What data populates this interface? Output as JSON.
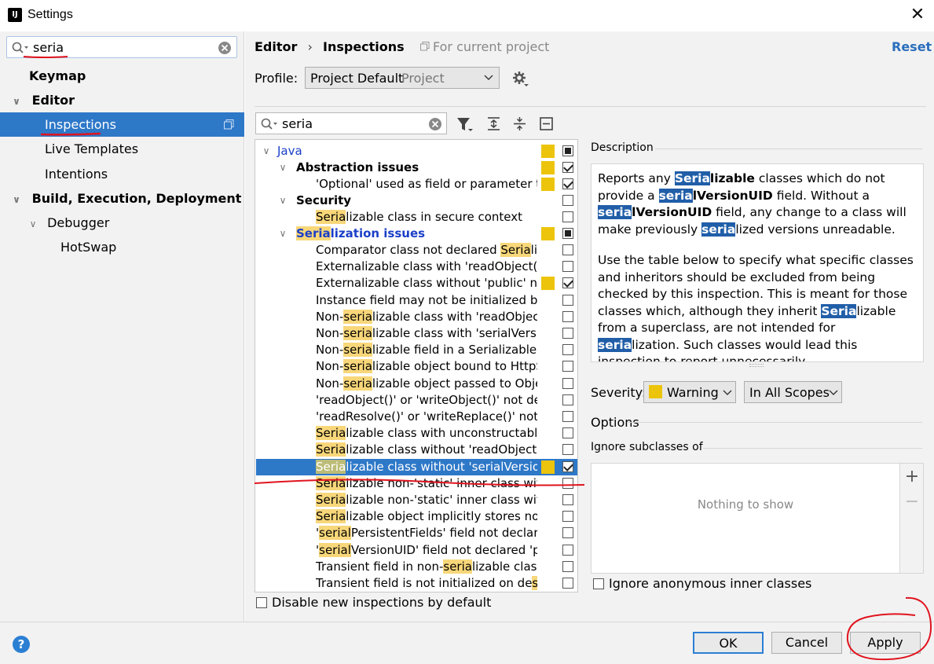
{
  "window": {
    "title": "Settings",
    "close": "✕"
  },
  "left": {
    "search_value": "seria",
    "tree": [
      {
        "label": "Keymap"
      },
      {
        "label": "Editor"
      },
      {
        "label": "Inspections"
      },
      {
        "label": "Live Templates"
      },
      {
        "label": "Intentions"
      },
      {
        "label": "Build, Execution, Deployment"
      },
      {
        "label": "Debugger"
      },
      {
        "label": "HotSwap"
      }
    ]
  },
  "header": {
    "crumb1": "Editor",
    "sep": "›",
    "crumb2": "Inspections",
    "scope_note": "For current project",
    "reset": "Reset"
  },
  "profile": {
    "label": "Profile:",
    "value": "Project Default",
    "value_kind": "Project"
  },
  "filter": {
    "search_value": "seria"
  },
  "inspections": {
    "java": "Java",
    "abstraction": {
      "label": "Abstraction issues",
      "child": "'Optional' used as field or parameter ty"
    },
    "security": {
      "label": "Security",
      "child": {
        "hl": "Seria",
        "rest": "lizable class in secure context"
      }
    },
    "serialization": {
      "hl": "Seria",
      "rest": "lization issues"
    },
    "items": [
      {
        "pre": "Comparator class not declared ",
        "hl": "Seria",
        "post": "liz",
        "checked": false,
        "yellow": false
      },
      {
        "pre": "Externalizable class with 'readObject()'",
        "hl": "",
        "post": "",
        "checked": false,
        "yellow": false
      },
      {
        "pre": "Externalizable class without 'public' no-",
        "hl": "",
        "post": "",
        "checked": true,
        "yellow": true
      },
      {
        "pre": "Instance field may not be initialized by",
        "hl": "",
        "post": "",
        "checked": false,
        "yellow": false
      },
      {
        "pre": "Non-",
        "hl": "seria",
        "post": "lizable class with 'readObject",
        "checked": false,
        "yellow": false
      },
      {
        "pre": "Non-",
        "hl": "seria",
        "post": "lizable class with 'serialVersio",
        "checked": false,
        "yellow": false
      },
      {
        "pre": "Non-",
        "hl": "seria",
        "post": "lizable field in a Serializable c",
        "checked": false,
        "yellow": false
      },
      {
        "pre": "Non-",
        "hl": "seria",
        "post": "lizable object bound to HttpS",
        "checked": false,
        "yellow": false
      },
      {
        "pre": "Non-",
        "hl": "seria",
        "post": "lizable object passed to Obje",
        "checked": false,
        "yellow": false
      },
      {
        "pre": "'readObject()' or 'writeObject()' not de",
        "hl": "",
        "post": "",
        "checked": false,
        "yellow": false
      },
      {
        "pre": "'readResolve()' or 'writeReplace()' not c",
        "hl": "",
        "post": "",
        "checked": false,
        "yellow": false
      },
      {
        "pre": "",
        "hl": "Seria",
        "post": "lizable class with unconstructable",
        "checked": false,
        "yellow": false
      },
      {
        "pre": "",
        "hl": "Seria",
        "post": "lizable class without 'readObject()",
        "checked": false,
        "yellow": false
      },
      {
        "pre": "",
        "hl": "Seria",
        "post": "lizable class without 'serialVersion",
        "checked": true,
        "yellow": true,
        "selected": true
      },
      {
        "pre": "",
        "hl": "Seria",
        "post": "lizable non-'static' inner class with",
        "checked": false,
        "yellow": false
      },
      {
        "pre": "",
        "hl": "Seria",
        "post": "lizable non-'static' inner class with",
        "checked": false,
        "yellow": false
      },
      {
        "pre": "",
        "hl": "Seria",
        "post": "lizable object implicitly stores non",
        "checked": false,
        "yellow": false
      },
      {
        "pre": "'",
        "hl": "serial",
        "post": "PersistentFields' field not declare",
        "checked": false,
        "yellow": false
      },
      {
        "pre": "'",
        "hl": "serial",
        "post": "VersionUID' field not declared 'pr",
        "checked": false,
        "yellow": false
      },
      {
        "pre": "Transient field in non-",
        "hl": "seria",
        "post": "lizable class",
        "checked": false,
        "yellow": false
      },
      {
        "pre": "Transient field is not initialized on de",
        "hl": "se",
        "post": "",
        "checked": false,
        "yellow": false
      }
    ],
    "disable_new": "Disable new inspections by default"
  },
  "description": {
    "title": "Description",
    "p1": [
      {
        "t": "Reports any ",
        "s": ""
      },
      {
        "t": "Seria",
        "s": "b"
      },
      {
        "t": "lizable",
        "s": "bold"
      },
      {
        "t": " classes which do not provide a ",
        "s": ""
      },
      {
        "t": "seria",
        "s": "b"
      },
      {
        "t": "lVersionUID",
        "s": "bold"
      },
      {
        "t": " field. Without a ",
        "s": ""
      },
      {
        "t": "seria",
        "s": "b"
      },
      {
        "t": "lVersionUID",
        "s": "bold"
      },
      {
        "t": " field, any change to a class will make previously ",
        "s": ""
      },
      {
        "t": "seria",
        "s": "b"
      },
      {
        "t": "lized versions unreadable.",
        "s": ""
      }
    ],
    "p2": [
      {
        "t": "Use the table below to specify what specific classes and inheritors should be excluded from being checked by this inspection. This is meant for those classes which, although they inherit ",
        "s": ""
      },
      {
        "t": "Seria",
        "s": "b"
      },
      {
        "t": "lizable from a superclass, are not intended for ",
        "s": ""
      },
      {
        "t": "seria",
        "s": "b"
      },
      {
        "t": "lization. Such classes would lead this inspection to report unnecessarily",
        "s": ""
      }
    ]
  },
  "severity": {
    "label": "Severity:",
    "value": "Warning",
    "scope": "In All Scopes"
  },
  "options": {
    "title": "Options",
    "ignore_subclasses": "Ignore subclasses of",
    "empty": "Nothing to show",
    "plus": "+",
    "minus": "−",
    "ignore_anon": "Ignore anonymous inner classes"
  },
  "buttons": {
    "ok": "OK",
    "cancel": "Cancel",
    "apply": "Apply",
    "help": "?"
  },
  "colors": {
    "selection": "#2e78c8",
    "highlight": "#f8d77a",
    "warning": "#ecc40c",
    "annotation": "#e0141e"
  }
}
